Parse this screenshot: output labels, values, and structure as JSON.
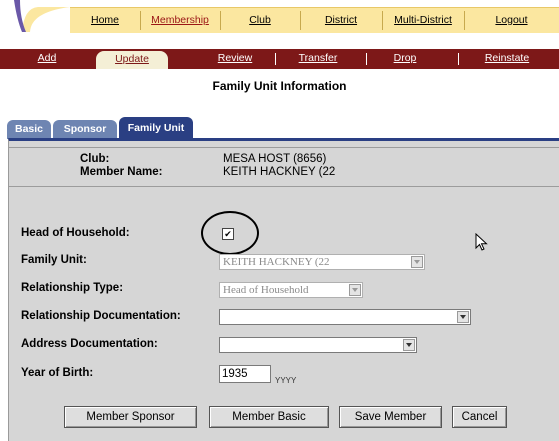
{
  "top_nav": {
    "items": [
      {
        "label": "Home",
        "active": false
      },
      {
        "label": "Membership",
        "active": true
      },
      {
        "label": "Club",
        "active": false
      },
      {
        "label": "District",
        "active": false
      },
      {
        "label": "Multi-District",
        "active": false
      },
      {
        "label": "Logout",
        "active": false
      }
    ]
  },
  "sub_nav": {
    "items": [
      {
        "label": "Add",
        "active": false
      },
      {
        "label": "Update",
        "active": true
      },
      {
        "label": "Review",
        "active": false
      },
      {
        "label": "Transfer",
        "active": false
      },
      {
        "label": "Drop",
        "active": false
      },
      {
        "label": "Reinstate",
        "active": false
      }
    ]
  },
  "page_title": "Family Unit Information",
  "tabs": [
    {
      "label": "Basic",
      "active": false
    },
    {
      "label": "Sponsor",
      "active": false
    },
    {
      "label": "Family Unit",
      "active": true
    }
  ],
  "info": {
    "club_label": "Club:",
    "club_value": "MESA HOST (8656)",
    "member_label": "Member Name:",
    "member_value": "KEITH HACKNEY (22"
  },
  "form": {
    "head_of_household_label": "Head of Household:",
    "head_of_household_checked": true,
    "head_of_household_mark": "✔",
    "family_unit_label": "Family Unit:",
    "family_unit_value": "KEITH HACKNEY (22",
    "relationship_type_label": "Relationship Type:",
    "relationship_type_value": "Head of Household",
    "relationship_doc_label": "Relationship Documentation:",
    "relationship_doc_value": "",
    "address_doc_label": "Address Documentation:",
    "address_doc_value": "",
    "year_of_birth_label": "Year of Birth:",
    "year_of_birth_value": "1935",
    "year_of_birth_hint": "YYYY"
  },
  "buttons": {
    "member_sponsor": "Member Sponsor",
    "member_basic": "Member Basic",
    "save_member": "Save Member",
    "cancel": "Cancel"
  },
  "colors": {
    "top_nav_bg": "#fbe7a0",
    "sub_nav_bg": "#7d1818",
    "tab_active": "#2a3f83",
    "tab_inactive": "#6e85b2",
    "panel_bg": "#d6d6d6"
  }
}
